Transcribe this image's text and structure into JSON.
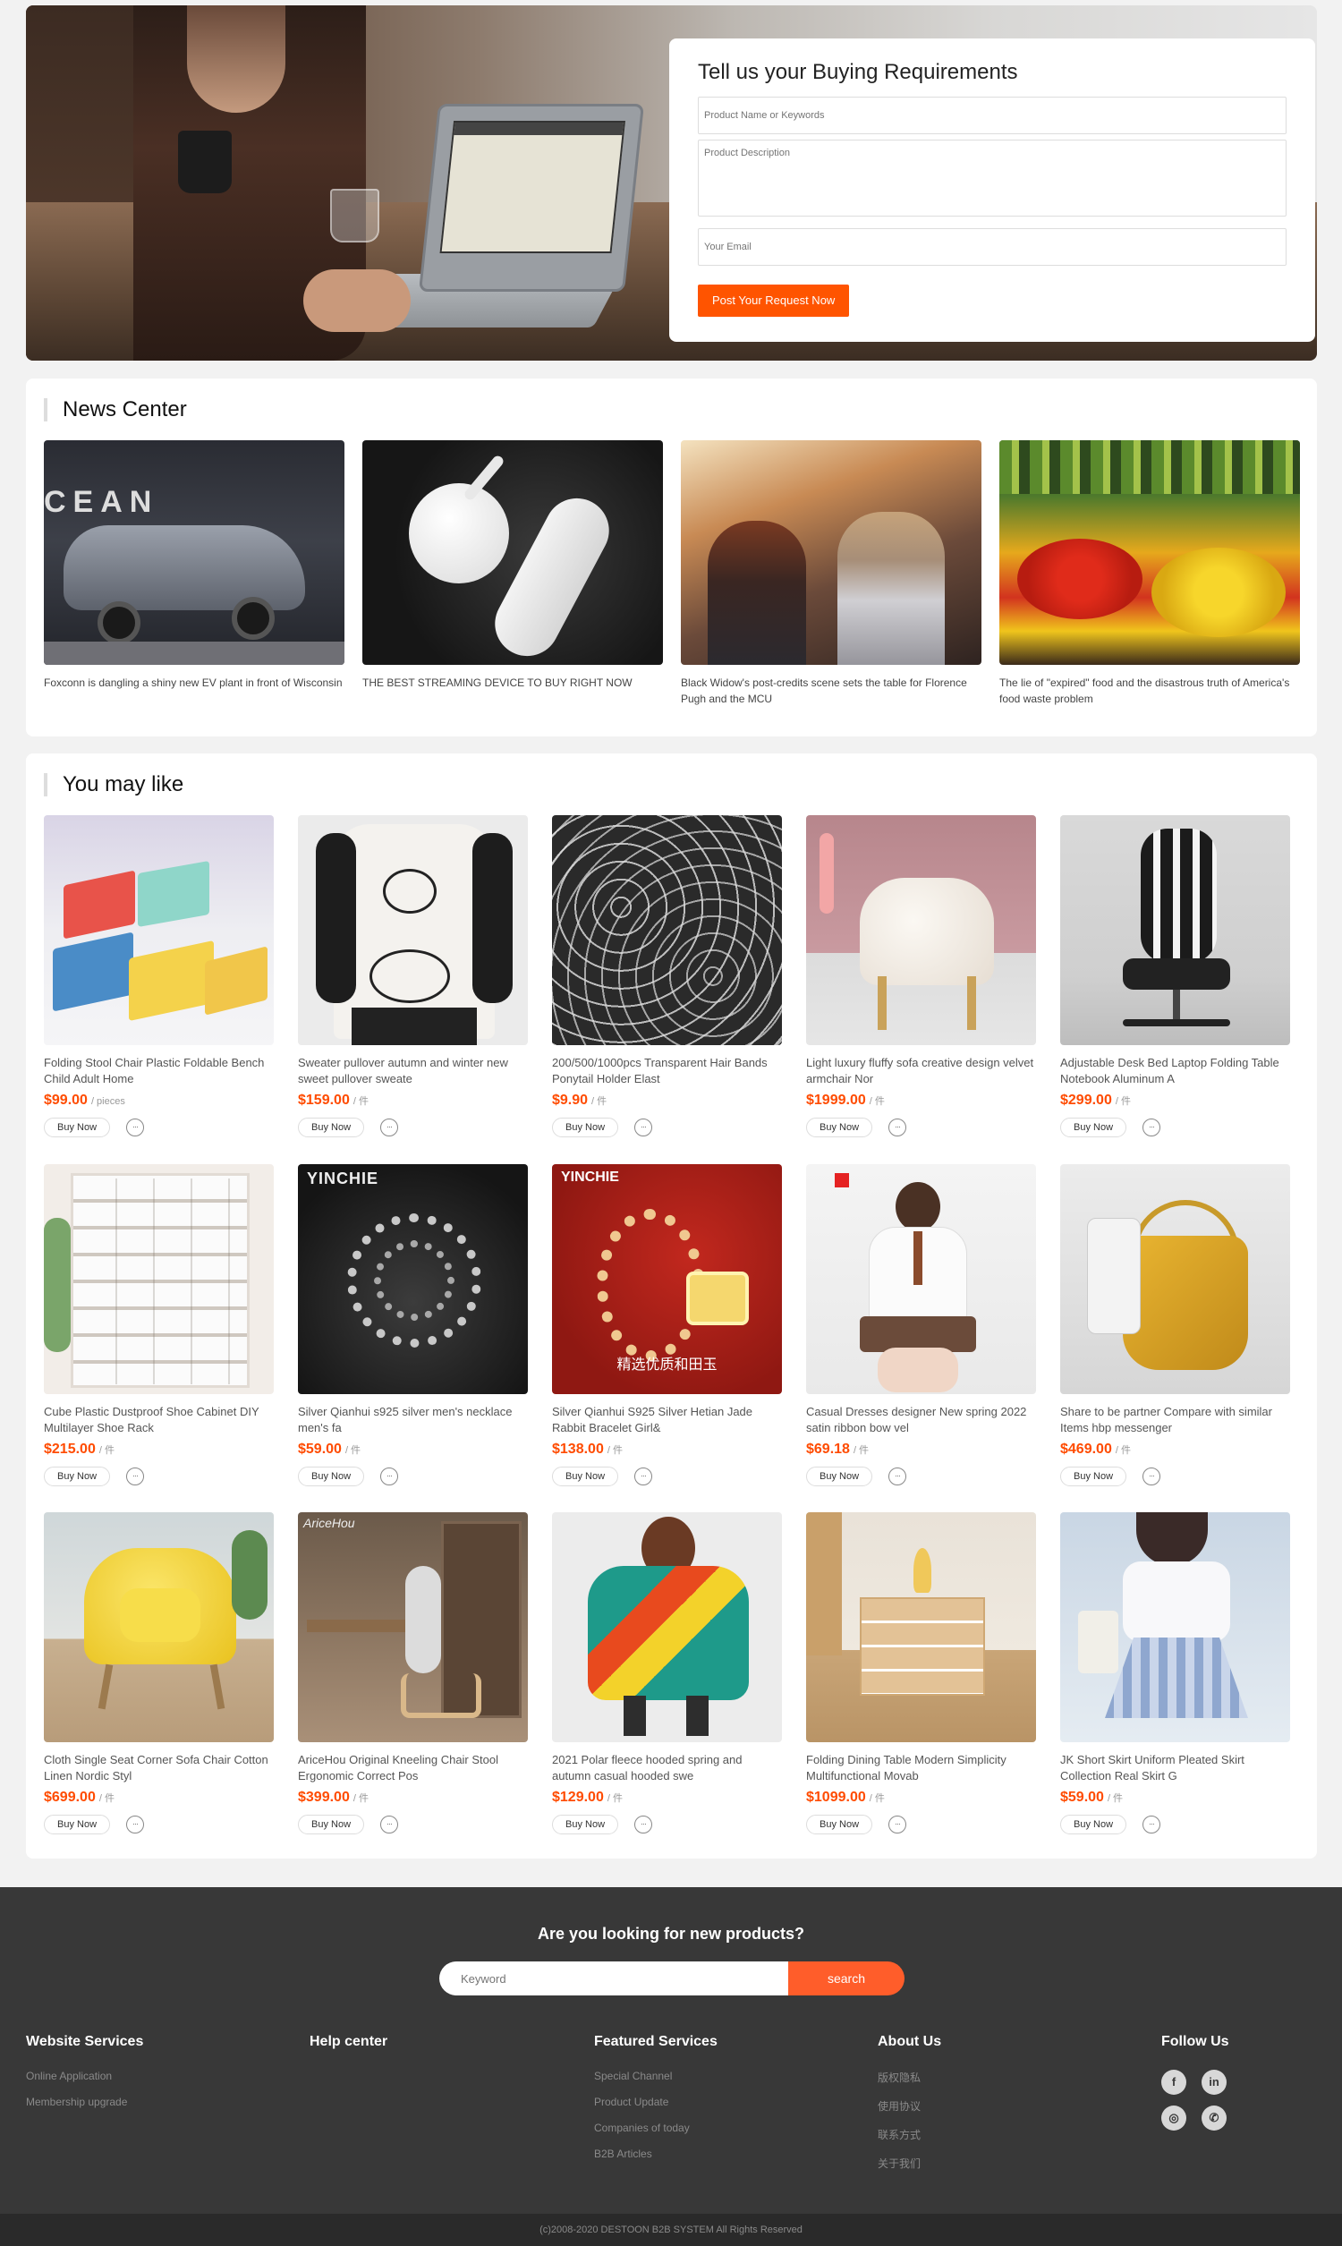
{
  "hero": {
    "title": "Tell us your Buying Requirements",
    "product_placeholder": "Product Name or Keywords",
    "description_placeholder": "Product Description",
    "email_placeholder": "Your Email",
    "submit_label": "Post Your Request Now"
  },
  "news": {
    "title": "News Center",
    "items": [
      {
        "caption": "Foxconn is dangling a shiny new EV plant in front of Wisconsin"
      },
      {
        "caption": "THE BEST STREAMING DEVICE TO BUY RIGHT NOW"
      },
      {
        "caption": "Black Widow's post-credits scene sets the table for Florence Pugh and the MCU"
      },
      {
        "caption": "The lie of \"expired\" food and the disastrous truth of America's food waste problem"
      }
    ]
  },
  "like": {
    "title": "You may like",
    "buy_label": "Buy Now",
    "chat_glyph": "···",
    "products": [
      {
        "name": "Folding Stool Chair Plastic Foldable Bench Child Adult Home",
        "price": "$99.00",
        "unit": "/ pieces"
      },
      {
        "name": "Sweater pullover autumn and winter new sweet pullover sweate",
        "price": "$159.00",
        "unit": "/ 件"
      },
      {
        "name": "200/500/1000pcs Transparent Hair Bands Ponytail Holder Elast",
        "price": "$9.90",
        "unit": "/ 件"
      },
      {
        "name": "Light luxury fluffy sofa creative design velvet armchair Nor",
        "price": "$1999.00",
        "unit": "/ 件"
      },
      {
        "name": "Adjustable Desk Bed Laptop Folding Table Notebook Aluminum A",
        "price": "$299.00",
        "unit": "/ 件"
      },
      {
        "name": "Cube Plastic Dustproof Shoe Cabinet DIY Multilayer Shoe Rack",
        "price": "$215.00",
        "unit": "/ 件"
      },
      {
        "name": "Silver Qianhui s925 silver men's necklace men's fa",
        "price": "$59.00",
        "unit": "/ 件",
        "img_text": "YINCHIE"
      },
      {
        "name": "Silver Qianhui S925 Silver Hetian Jade Rabbit Bracelet Girl&",
        "price": "$138.00",
        "unit": "/ 件",
        "img_text": "YINCHIE",
        "img_text2": "精选优质和田玉"
      },
      {
        "name": "Casual Dresses designer New spring 2022 satin ribbon bow vel",
        "price": "$69.18",
        "unit": "/ 件"
      },
      {
        "name": "Share to be partner Compare with similar Items hbp messenger",
        "price": "$469.00",
        "unit": "/ 件"
      },
      {
        "name": "Cloth Single Seat Corner Sofa Chair Cotton Linen Nordic Styl",
        "price": "$699.00",
        "unit": "/ 件"
      },
      {
        "name": "AriceHou Original Kneeling Chair Stool Ergonomic Correct Pos",
        "price": "$399.00",
        "unit": "/ 件",
        "img_text": "AriceHou"
      },
      {
        "name": "2021 Polar fleece hooded spring and autumn casual hooded swe",
        "price": "$129.00",
        "unit": "/ 件"
      },
      {
        "name": "Folding Dining Table Modern Simplicity Multifunctional Movab",
        "price": "$1099.00",
        "unit": "/ 件"
      },
      {
        "name": "JK Short Skirt Uniform Pleated Skirt Collection Real Skirt G",
        "price": "$59.00",
        "unit": "/ 件"
      }
    ]
  },
  "footer": {
    "question": "Are you looking for new products?",
    "search_placeholder": "Keyword",
    "search_label": "search",
    "columns": [
      {
        "title": "Website Services",
        "links": [
          "Online Application",
          "Membership upgrade"
        ]
      },
      {
        "title": "Help center",
        "links": []
      },
      {
        "title": "Featured Services",
        "links": [
          "Special Channel",
          "Product Update",
          "Companies of today",
          "B2B Articles"
        ]
      },
      {
        "title": "About Us",
        "links": [
          "版权隐私",
          "使用协议",
          "联系方式",
          "关于我们"
        ]
      }
    ],
    "follow_title": "Follow Us",
    "social": [
      {
        "icon": "facebook-icon",
        "glyph": "f"
      },
      {
        "icon": "linkedin-icon",
        "glyph": "in"
      },
      {
        "icon": "instagram-icon",
        "glyph": "◎"
      },
      {
        "icon": "wechat-icon",
        "glyph": "✆"
      }
    ],
    "copyright": "(c)2008-2020 DESTOON B2B SYSTEM All Rights Reserved"
  },
  "colors": {
    "accent": "#ff5400",
    "price": "#ff4b00",
    "footer_bg": "#383838"
  }
}
